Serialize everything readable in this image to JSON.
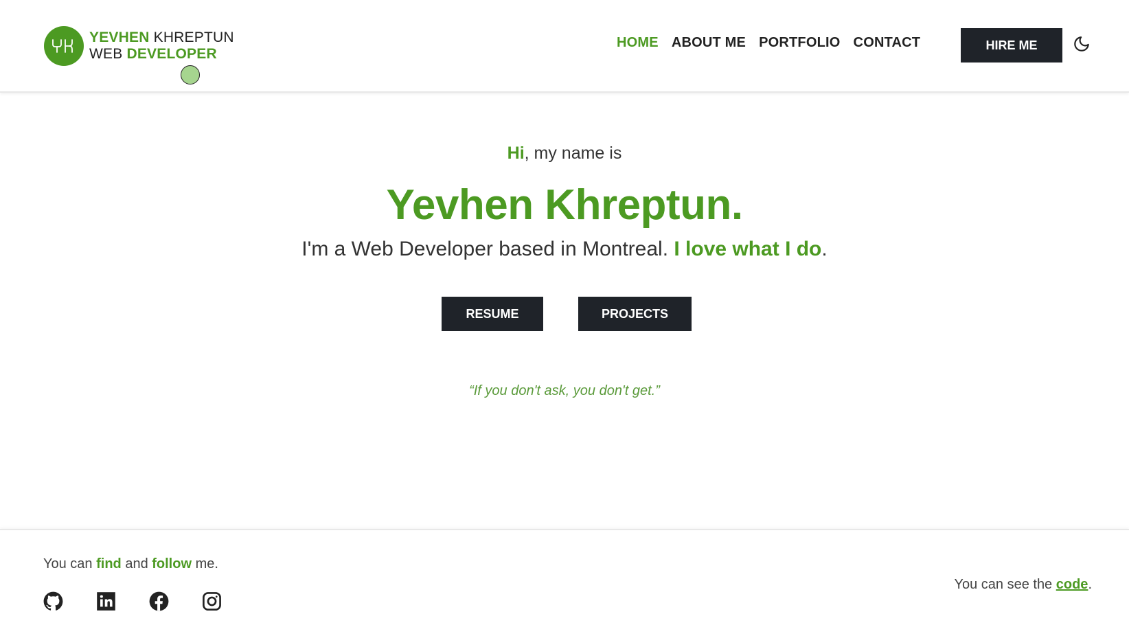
{
  "header": {
    "logo_initials": "YK",
    "logo_line1_green": "YEVHEN",
    "logo_line1_dark": "KHREPTUN",
    "logo_line2_dark": "WEB",
    "logo_line2_green": "DEVELOPER",
    "nav": [
      {
        "label": "HOME",
        "active": true
      },
      {
        "label": "ABOUT ME",
        "active": false
      },
      {
        "label": "PORTFOLIO",
        "active": false
      },
      {
        "label": "CONTACT",
        "active": false
      }
    ],
    "hire_label": "HIRE ME",
    "theme_icon": "moon-icon"
  },
  "hero": {
    "greet_green": "Hi",
    "greet_rest": ", my name is",
    "name": "Yevhen Khreptun.",
    "tagline_plain": "I'm a Web Developer based in Montreal. ",
    "tagline_green": "I love what I do",
    "tagline_end": ".",
    "resume_label": "RESUME",
    "projects_label": "PROJECTS",
    "quote": "“If you don't ask, you don't get.”"
  },
  "footer": {
    "follow_1": "You can ",
    "follow_find": "find",
    "follow_2": " and ",
    "follow_follow": "follow",
    "follow_3": " me.",
    "socials": [
      "github-icon",
      "linkedin-icon",
      "facebook-icon",
      "instagram-icon"
    ],
    "code_prefix": "You can see the ",
    "code_link": "code",
    "code_suffix": "."
  },
  "colors": {
    "accent": "#4c9a22",
    "dark_button": "#1f2329",
    "cursor_dot": "#a6d58f"
  }
}
